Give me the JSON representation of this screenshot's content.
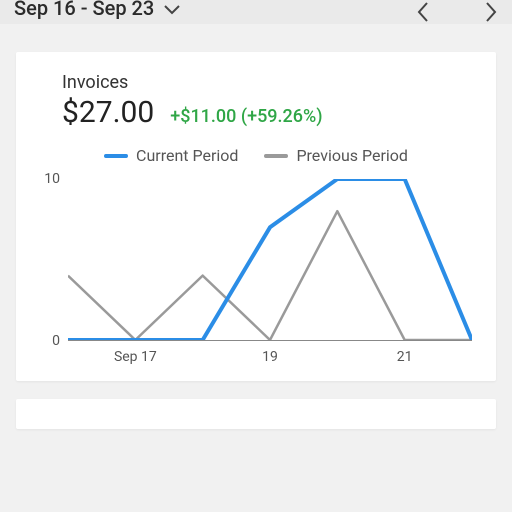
{
  "topbar": {
    "date_range": "Sep 16 - Sep 23"
  },
  "card": {
    "title": "Invoices",
    "amount": "$27.00",
    "delta": "+$11.00 (+59.26%)"
  },
  "legend": {
    "current": "Current Period",
    "previous": "Previous Period"
  },
  "yticks": {
    "y0": "0",
    "y1": "10"
  },
  "xticks": {
    "x0": "Sep 17",
    "x1": "19",
    "x2": "21"
  },
  "chart_data": {
    "type": "line",
    "x": [
      "Sep 16",
      "Sep 17",
      "Sep 18",
      "Sep 19",
      "Sep 20",
      "Sep 21",
      "Sep 22"
    ],
    "series": [
      {
        "name": "Current Period",
        "values": [
          0,
          0,
          0,
          7,
          10,
          10,
          0
        ],
        "color": "#2b8de6"
      },
      {
        "name": "Previous Period",
        "values": [
          4,
          0,
          4,
          0,
          8,
          0,
          0
        ],
        "color": "#9a9a9a"
      }
    ],
    "ylim": [
      0,
      10
    ],
    "xticks_shown": [
      "Sep 17",
      "19",
      "21"
    ],
    "title": "Invoices",
    "xlabel": "",
    "ylabel": ""
  }
}
